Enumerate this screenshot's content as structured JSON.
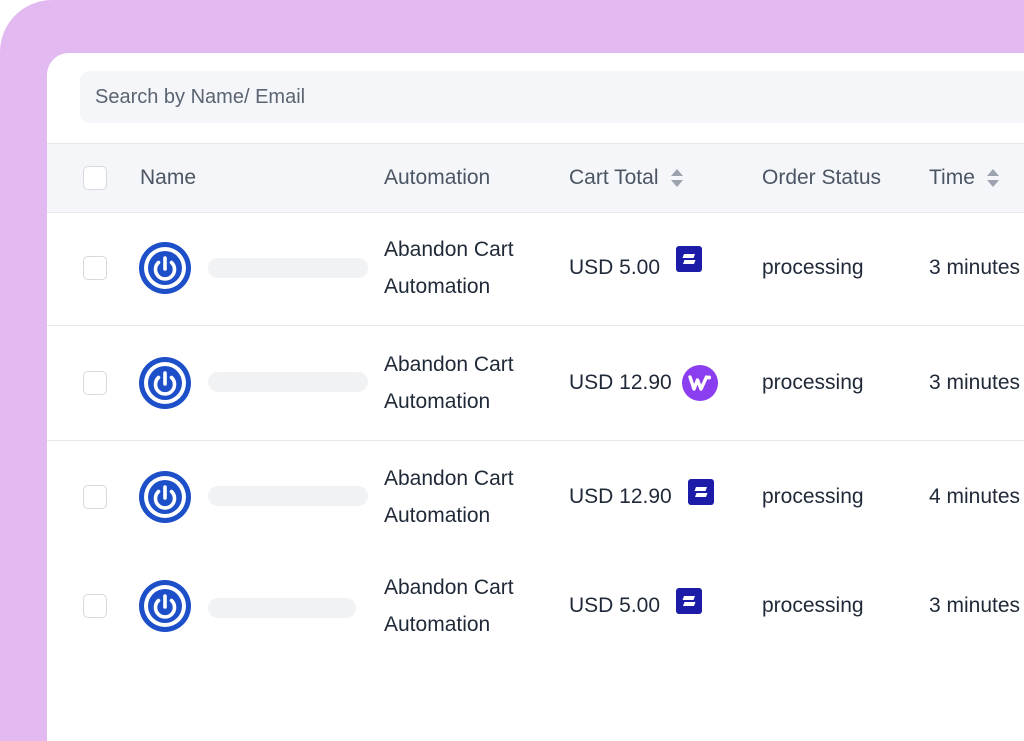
{
  "search": {
    "placeholder": "Search by Name/ Email"
  },
  "columns": {
    "name": "Name",
    "automation": "Automation",
    "cart_total": "Cart Total",
    "order_status": "Order Status",
    "time": "Time"
  },
  "rows": [
    {
      "automation": "Abandon Cart Automation",
      "cart_total": "USD 5.00",
      "store_icon": "stripe-like-icon",
      "order_status": "processing",
      "time": "3 minutes"
    },
    {
      "automation": "Abandon Cart Automation",
      "cart_total": "USD 12.90",
      "store_icon": "woocommerce-icon",
      "order_status": "processing",
      "time": "3 minutes"
    },
    {
      "automation": "Abandon Cart Automation",
      "cart_total": "USD 12.90",
      "store_icon": "stripe-like-icon",
      "order_status": "processing",
      "time": "4 minutes"
    },
    {
      "automation": "Abandon Cart Automation",
      "cart_total": "USD 5.00",
      "store_icon": "stripe-like-icon",
      "order_status": "processing",
      "time": "3 minutes"
    }
  ],
  "colors": {
    "frame": "#e3b9f1",
    "avatar": "#1d4fc9",
    "stripe_badge": "#1c1ca8",
    "woo_badge": "#8b3df0"
  }
}
